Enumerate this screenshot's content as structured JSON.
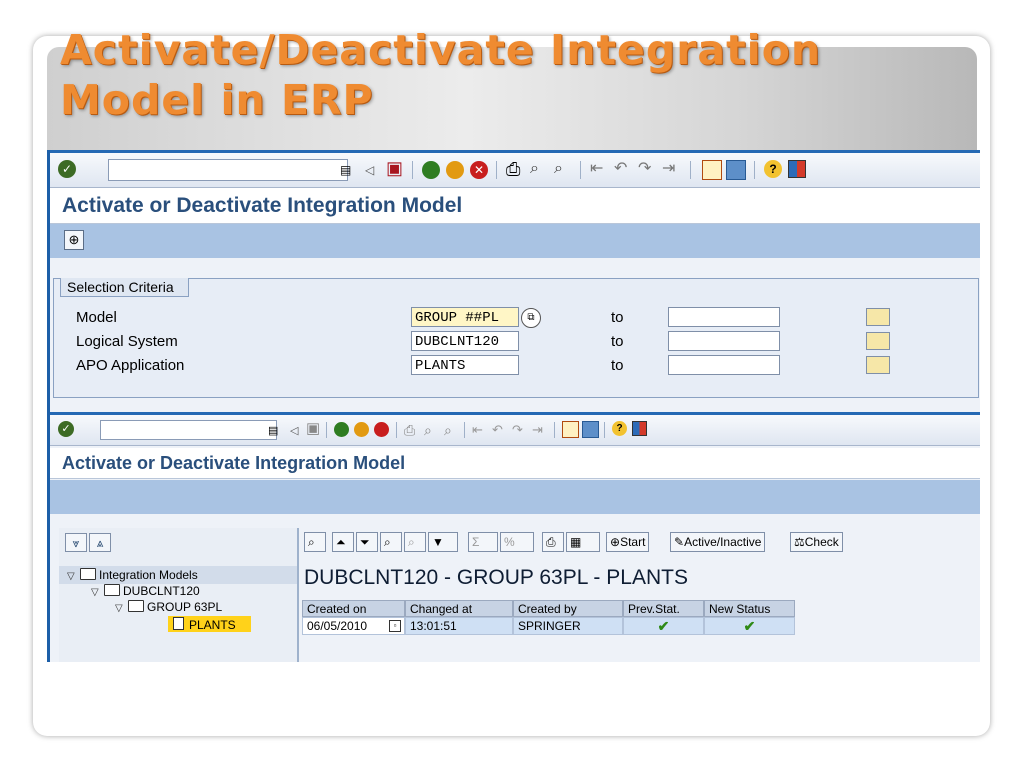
{
  "slide": {
    "title": "Activate/Deactivate Integration Model in ERP"
  },
  "screen1": {
    "window_title": "Activate or Deactivate Integration Model",
    "selection_group_title": "Selection Criteria",
    "rows": [
      {
        "label": "Model",
        "value": "GROUP ##PL",
        "to": "to"
      },
      {
        "label": "Logical System",
        "value": "DUBCLNT120",
        "to": "to"
      },
      {
        "label": "APO Application",
        "value": "PLANTS",
        "to": "to"
      }
    ]
  },
  "screen2": {
    "window_title": "Activate or Deactivate Integration Model",
    "tree": {
      "root": "Integration Models",
      "system": "DUBCLNT120",
      "group": "GROUP 63PL",
      "application": "PLANTS"
    },
    "toolbar": {
      "start_label": "Start",
      "active_inactive_label": "Active/Inactive",
      "check_label": "Check"
    },
    "grid_caption": "DUBCLNT120 - GROUP 63PL - PLANTS",
    "columns": [
      "Created on",
      "Changed at",
      "Created by",
      "Prev.Stat.",
      "New Status"
    ],
    "row": {
      "created_on": "06/05/2010",
      "changed_at": "13:01:51",
      "created_by": "SPRINGER",
      "prev_status": "✔",
      "new_status": "✔"
    }
  },
  "colors": {
    "title_orange": "#ef8b31",
    "sap_blue": "#2569b4",
    "highlight_yellow": "#ffd21a"
  }
}
